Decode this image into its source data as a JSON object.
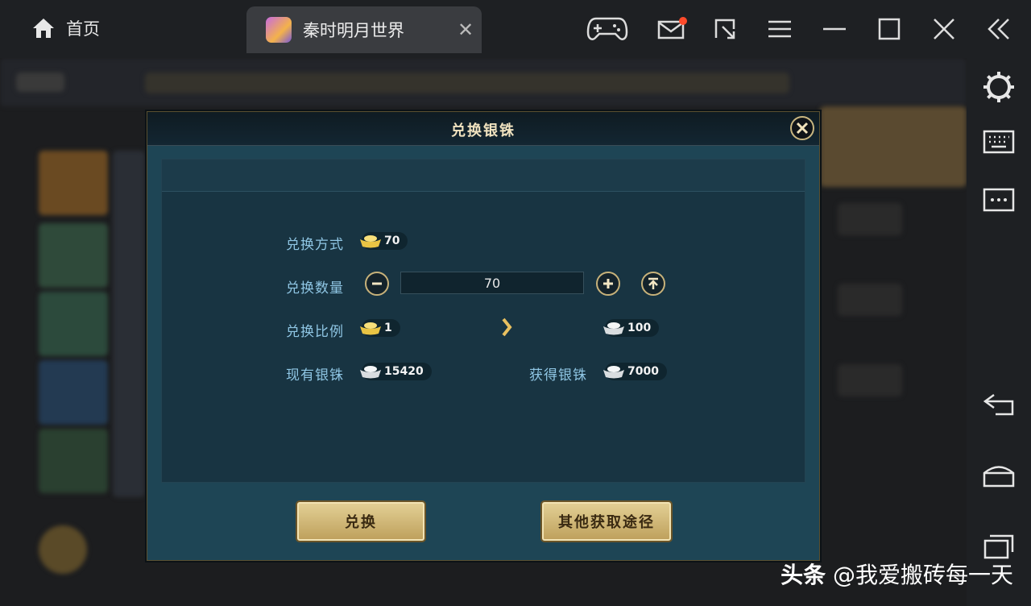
{
  "topbar": {
    "home_label": "首页",
    "tab_label": "秦时明月世界",
    "tab_close": "✕"
  },
  "dialog": {
    "title": "兑换银铢",
    "rows": {
      "method_label": "兑换方式",
      "method_value": "70",
      "quantity_label": "兑换数量",
      "quantity_value": "70",
      "ratio_label": "兑换比例",
      "ratio_left_value": "1",
      "ratio_right_value": "100",
      "current_label": "现有银铢",
      "current_value": "15420",
      "gain_label": "获得银铢",
      "gain_value": "7000"
    },
    "buttons": {
      "exchange": "兑换",
      "other_ways": "其他获取途径"
    }
  },
  "watermark": {
    "brand": "头条",
    "account": "@我爱搬砖每一天"
  },
  "colors": {
    "accent_gold": "#c8b27a",
    "label_blue": "#8fc6e4",
    "dialog_bg": "#1e4555",
    "notification_dot": "#ff4a2a"
  },
  "icons": [
    "home-icon",
    "gamepad-icon",
    "mail-icon",
    "resize-icon",
    "menu-icon",
    "minimize-icon",
    "maximize-icon",
    "close-icon",
    "collapse-icon",
    "settings-icon",
    "keyboard-icon",
    "more-icon",
    "back-icon",
    "android-home-icon",
    "recent-apps-icon",
    "gold-ingot-icon",
    "silver-ingot-icon"
  ]
}
